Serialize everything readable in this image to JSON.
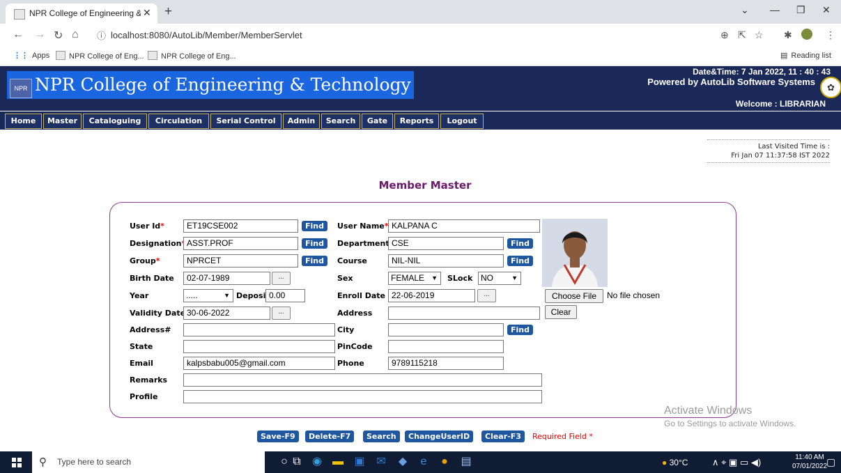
{
  "browser": {
    "tab_title": "NPR College of Engineering & Te",
    "url": "localhost:8080/AutoLib/Member/MemberServlet",
    "bookmarks": [
      "Apps",
      "NPR College of Eng...",
      "NPR College of Eng..."
    ],
    "reading_list": "Reading list"
  },
  "header": {
    "college_name": "NPR College of Engineering & Technology",
    "logo_text": "NPR",
    "datetime": "Date&Time:  7 Jan 2022, 11 : 40 : 43",
    "powered_by": "Powered by AutoLib Software Systems",
    "welcome": "Welcome   :  LIBRARIAN"
  },
  "menu": [
    "Home",
    "Master",
    "Cataloguing",
    "Circulation",
    "Serial Control",
    "Admin",
    "Search",
    "Gate",
    "Reports",
    "Logout"
  ],
  "last_visited": {
    "label": "Last Visited Time is :",
    "value": "Fri Jan 07 11:37:58 IST 2022"
  },
  "page_title": "Member Master",
  "form": {
    "labels": {
      "user_id": "User Id",
      "user_name": "User Name",
      "designation": "Designation",
      "department": "Department",
      "group": "Group",
      "course": "Course",
      "birth_date": "Birth Date",
      "sex": "Sex",
      "slock": "SLock",
      "year": "Year",
      "deposit": "Deposit",
      "enroll_date": "Enroll Date",
      "validity_date": "Validity Date",
      "address": "Address",
      "address2": "Address#",
      "city": "City",
      "state": "State",
      "pincode": "PinCode",
      "email": "Email",
      "phone": "Phone",
      "remarks": "Remarks",
      "profile": "Profile"
    },
    "required_mark": "*",
    "values": {
      "user_id": "ET19CSE002",
      "user_name": "KALPANA C",
      "designation": "ASST.PROF",
      "department": "CSE",
      "group": "NPRCET",
      "course": "NIL-NIL",
      "birth_date": "02-07-1989",
      "sex": "FEMALE",
      "slock": "NO",
      "year": ".....",
      "deposit": "0.00",
      "enroll_date": "22-06-2019",
      "validity_date": "30-06-2022",
      "address": "",
      "address2": "",
      "city": "",
      "state": "",
      "pincode": "",
      "email": "kalpsbabu005@gmail.com",
      "phone": "9789115218",
      "remarks": "",
      "profile": ""
    },
    "find_label": "Find",
    "calendar_label": "...",
    "choose_file": "Choose File",
    "no_file": "No file chosen",
    "clear": "Clear"
  },
  "actions": [
    "Save-F9",
    "Delete-F7",
    "Search",
    "ChangeUserID",
    "Clear-F3"
  ],
  "required_note": "Required Field *",
  "watermark": {
    "line1": "Activate Windows",
    "line2": "Go to Settings to activate Windows."
  },
  "taskbar": {
    "search_placeholder": "Type here to search",
    "weather": "30°C",
    "time": "11:40 AM",
    "date": "07/01/2022"
  }
}
